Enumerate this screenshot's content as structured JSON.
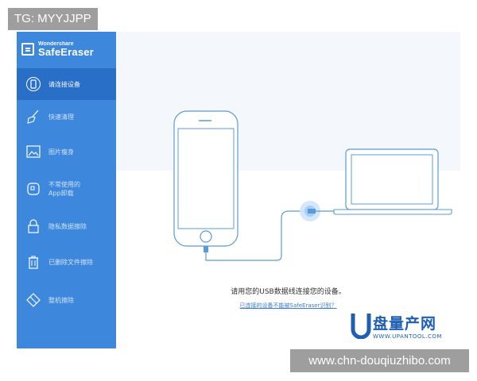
{
  "watermarks": {
    "top": "TG: MYYJJPP",
    "bottom": "www.chn-douqiuzhibo.com"
  },
  "app": {
    "brand_small": "Wondershare",
    "brand_big": "SafeEraser"
  },
  "sidebar": {
    "items": [
      {
        "label": "请连接设备",
        "icon": "phone-icon",
        "active": true
      },
      {
        "label": "快速清理",
        "icon": "broom-icon",
        "active": false
      },
      {
        "label": "图片瘦身",
        "icon": "image-icon",
        "active": false
      },
      {
        "label_line1": "不常使用的",
        "label_line2": "App卸载",
        "icon": "app-icon",
        "active": false
      },
      {
        "label": "隐私数据擦除",
        "icon": "lock-icon",
        "active": false
      },
      {
        "label": "已删除文件擦除",
        "icon": "trash-icon",
        "active": false
      },
      {
        "label": "整机擦除",
        "icon": "eraser-icon",
        "active": false
      }
    ]
  },
  "main": {
    "message": "请用您的USB数据线连接您的设备。",
    "link": "已连接的设备不能被SafeEraser识别？"
  },
  "logo": {
    "text": "盘量产网",
    "sub": "WWW.UPANTOOL.COM"
  },
  "colors": {
    "sidebar": "#3d88dc",
    "sidebar_active": "#2a6fc7",
    "illustration_stroke": "#5b9bd5",
    "link": "#3a7bd5"
  }
}
